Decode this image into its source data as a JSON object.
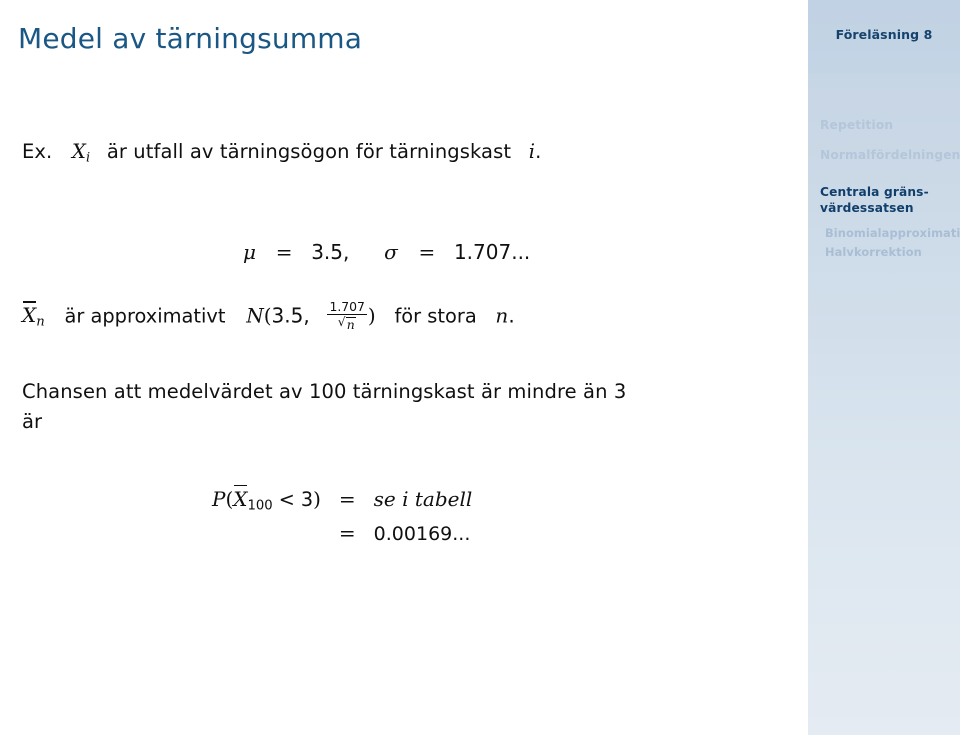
{
  "slide": {
    "title": "Medel av tärningsumma",
    "lecture_label": "Föreläsning 8"
  },
  "sidebar": {
    "items": [
      {
        "label": "Repetition",
        "level": "section",
        "active": false
      },
      {
        "label": "Normalfördelningen",
        "level": "section",
        "active": false
      },
      {
        "label": "Centrala gräns-\nvärdessatsen",
        "level": "section",
        "active": true
      },
      {
        "label": "Binomialapproximation",
        "level": "subsection",
        "active": false
      },
      {
        "label": "Halvkorrektion",
        "level": "subsection",
        "active": false
      }
    ],
    "item_labels": {
      "repetition": "Repetition",
      "normal": "Normalfördelningen",
      "clt_line1": "Centrala gräns-",
      "clt_line2": "värdessatsen",
      "binomial": "Binomialapproximation",
      "halvkorrektion": "Halvkorrektion"
    }
  },
  "content": {
    "example_prefix": "Ex.",
    "example_var": "X",
    "example_var_sub": "i",
    "example_text": "är utfall av tärningsögon för tärningskast",
    "example_index": "i",
    "example_period": ".",
    "params": {
      "mu_symbol": "μ",
      "mu_eq": "=",
      "mu_value": "3.5,",
      "sigma_symbol": "σ",
      "sigma_eq": "=",
      "sigma_value": "1.707..."
    },
    "approx": {
      "var": "X",
      "var_sub": "n",
      "text_1": "är approximativt",
      "dist": "N",
      "open_paren": "(",
      "mean": "3.5,",
      "sd_numerator": "1.707",
      "sd_denominator_sqrt": "n",
      "close_paren": ")",
      "text_2": "för stora",
      "text_n": "n",
      "text_period": "."
    },
    "question": {
      "line1": "Chansen att medelvärdet av 100 tärningskast är mindre än 3",
      "line2": "är"
    },
    "final_equation": {
      "rows": [
        {
          "lhs_P": "P",
          "lhs_open": "(",
          "lhs_var": "X",
          "lhs_sub": "100",
          "lhs_rel": "< 3",
          "lhs_close": ")",
          "rel": "=",
          "rhs": "se i tabell",
          "rhs_italic": true
        },
        {
          "lhs_P": "",
          "lhs_open": "",
          "lhs_var": "",
          "lhs_sub": "",
          "lhs_rel": "",
          "lhs_close": "",
          "rel": "=",
          "rhs": "0.00169...",
          "rhs_italic": false
        }
      ],
      "row1_rhs": "se i tabell",
      "row2_rhs": "0.00169...",
      "rel_symbol": "="
    }
  },
  "colors": {
    "title_blue": "#1a5784",
    "sidebar_active": "#113f6b",
    "sidebar_inactive": "#b4c6da",
    "sidebar_bg_top": "#c4d4e4",
    "sidebar_bg_bottom": "#e5ebf2",
    "body_text": "#101010",
    "page_bg": "#ffffff"
  }
}
